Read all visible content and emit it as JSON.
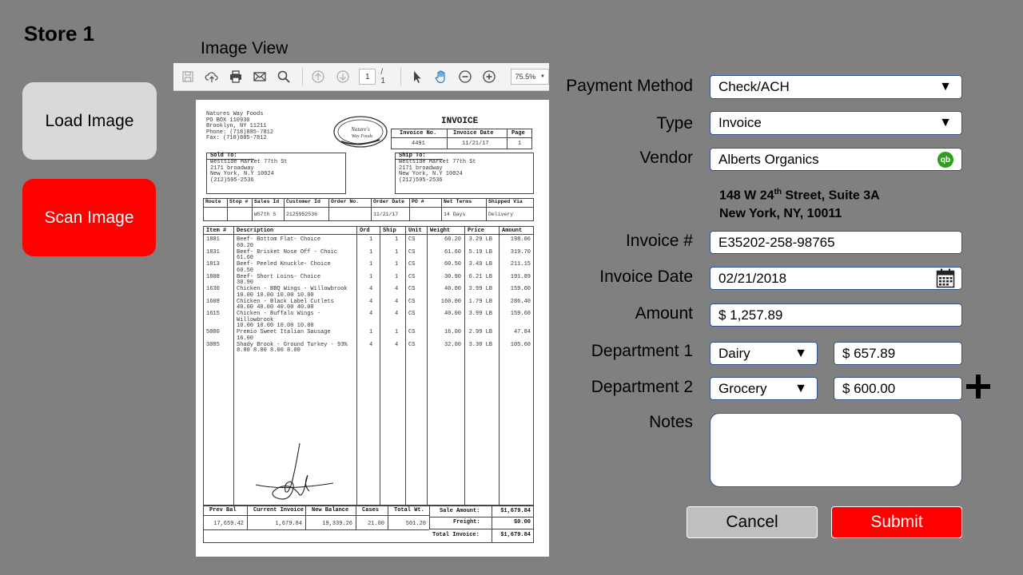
{
  "store": {
    "title": "Store 1"
  },
  "sidebar": {
    "load_label": "Load Image",
    "scan_label": "Scan Image"
  },
  "image_view": {
    "title": "Image View",
    "toolbar": {
      "page_current": "1",
      "page_total": "/ 1",
      "zoom": "75.5%",
      "icons": [
        "save-icon",
        "upload-icon",
        "print-icon",
        "email-icon",
        "search-icon",
        "previous-page-icon",
        "next-page-icon",
        "select-pointer-icon",
        "hand-tool-icon",
        "zoom-out-icon",
        "zoom-in-icon"
      ]
    },
    "document": {
      "vendor_name": "Natures Way Foods",
      "vendor_address": [
        "PO BOX 110930",
        "Brooklyn, NY 11211",
        "Phone: (718)885-7812",
        "Fax: (718)885-7812"
      ],
      "logo_text": "Nature's Way Foods",
      "heading": "INVOICE",
      "invoice_no_label": "Invoice No.",
      "invoice_no": "4491",
      "invoice_date_label": "Invoice Date",
      "invoice_date": "11/21/17",
      "page_label": "Page",
      "page": "1",
      "sold_to_label": "Sold To:",
      "sold_to": [
        "Westside Market 77th St",
        "2171 broadway",
        "New York, N.Y 10024",
        "(212)595-2536"
      ],
      "ship_to_label": "Ship To:",
      "ship_to": [
        "Westside Market 77th St",
        "2171 broadway",
        "New York, N.Y 10024",
        "(212)595-2536"
      ],
      "order_headers": [
        "Route",
        "Stop #",
        "Sales Id",
        "Customer Id",
        "Order No.",
        "Order Date",
        "PO #",
        "Net Terms",
        "Shipped Via"
      ],
      "order_values": [
        "",
        "",
        "WS7th S",
        "2125952536",
        "",
        "11/21/17",
        "",
        "14 Days",
        "Delivery"
      ],
      "item_headers": [
        "Item #",
        "Description",
        "Ord",
        "Ship",
        "Unit",
        "Weight",
        "Price",
        "Amount"
      ],
      "items": [
        {
          "item": "1801",
          "desc": [
            "Beef- Bottom Flat- Choice",
            "60.20"
          ],
          "ord": "1",
          "ship": "1",
          "unit": "CS",
          "weight": "60.20",
          "price": "3.29 LB",
          "amount": "198.06"
        },
        {
          "item": "1831",
          "desc": [
            "Beef- Brisket Nose Off - Choic",
            "61.60"
          ],
          "ord": "1",
          "ship": "1",
          "unit": "CS",
          "weight": "61.60",
          "price": "5.19 LB",
          "amount": "319.70"
        },
        {
          "item": "1813",
          "desc": [
            "Beef- Peeled Knuckle- Choice",
            "60.50"
          ],
          "ord": "1",
          "ship": "1",
          "unit": "CS",
          "weight": "60.50",
          "price": "3.49 LB",
          "amount": "211.15"
        },
        {
          "item": "1808",
          "desc": [
            "Beef- Short Loins- Choice",
            "30.90"
          ],
          "ord": "1",
          "ship": "1",
          "unit": "CS",
          "weight": "30.90",
          "price": "6.21 LB",
          "amount": "191.89"
        },
        {
          "item": "1630",
          "desc": [
            "Chicken - BBQ Wings - Willowbrook",
            "10.00 10.00 10.00 10.00"
          ],
          "ord": "4",
          "ship": "4",
          "unit": "CS",
          "weight": "40.00",
          "price": "3.99 LB",
          "amount": "159.60"
        },
        {
          "item": "1608",
          "desc": [
            "Chicken - Black Label Cutlets",
            "40.00 40.00 40.00 40.00"
          ],
          "ord": "4",
          "ship": "4",
          "unit": "CS",
          "weight": "160.00",
          "price": "1.79 LB",
          "amount": "286.40"
        },
        {
          "item": "1615",
          "desc": [
            "Chicken - Buffalo Wings -",
            "Willowbrook",
            "10.00 10.00 10.00 10.00"
          ],
          "ord": "4",
          "ship": "4",
          "unit": "CS",
          "weight": "40.00",
          "price": "3.99 LB",
          "amount": "159.60"
        },
        {
          "item": "5000",
          "desc": [
            "Premio Sweet Italian Sausage",
            "16.00"
          ],
          "ord": "1",
          "ship": "1",
          "unit": "CS",
          "weight": "16.00",
          "price": "2.99 LB",
          "amount": "47.84"
        },
        {
          "item": "3005",
          "desc": [
            "Shady Brook - Ground Turkey - 93%",
            "8.00 8.00 8.00 8.00"
          ],
          "ord": "4",
          "ship": "4",
          "unit": "CS",
          "weight": "32.00",
          "price": "3.30 LB",
          "amount": "105.60"
        }
      ],
      "footer_headers": [
        "Prev Bal",
        "Current Invoice",
        "New Balance",
        "Cases",
        "Total Wt."
      ],
      "footer_values": [
        "17,659.42",
        "1,679.84",
        "19,339.26",
        "21.00",
        "501.20"
      ],
      "sale_amount_label": "Sale Amount:",
      "sale_amount": "$1,679.84",
      "freight_label": "Freight:",
      "freight": "$0.00",
      "total_label": "Total Invoice:",
      "total": "$1,679.84"
    }
  },
  "form": {
    "payment_method": {
      "label": "Payment Method",
      "value": "Check/ACH"
    },
    "type": {
      "label": "Type",
      "value": "Invoice"
    },
    "vendor": {
      "label": "Vendor",
      "value": "Alberts Organics",
      "badge": "qb"
    },
    "vendor_address": {
      "street_prefix": "148 W 24",
      "street_sup": "th",
      "street_suffix": " Street, Suite 3A",
      "city": "New York, NY, 10011"
    },
    "invoice_number": {
      "label": "Invoice #",
      "value": "E35202-258-98765"
    },
    "invoice_date": {
      "label": "Invoice Date",
      "value": "02/21/2018"
    },
    "amount": {
      "label": "Amount",
      "value": "$ 1,257.89"
    },
    "department1": {
      "label": "Department 1",
      "value": "Dairy",
      "amount": "$ 657.89"
    },
    "department2": {
      "label": "Department 2",
      "value": "Grocery",
      "amount": "$ 600.00"
    },
    "notes": {
      "label": "Notes",
      "value": ""
    },
    "dropdown_glyph": "▼",
    "cancel_label": "Cancel",
    "submit_label": "Submit"
  }
}
